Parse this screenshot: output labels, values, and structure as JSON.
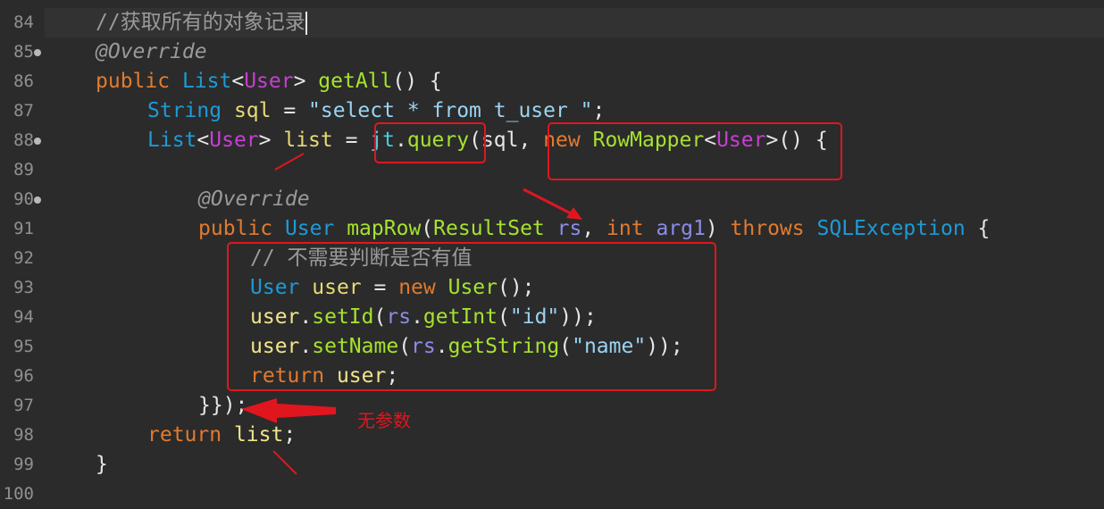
{
  "editor": {
    "line_numbers": [
      "84",
      "85",
      "86",
      "87",
      "88",
      "89",
      "90",
      "91",
      "92",
      "93",
      "94",
      "95",
      "96",
      "97",
      "98",
      "99",
      "100"
    ],
    "lines": {
      "l84": [
        "//获取所有的对象记录"
      ],
      "l85": [
        "@Override"
      ],
      "l86": [
        "public",
        " ",
        "List",
        "<",
        "User",
        "> ",
        "getAll",
        "() {"
      ],
      "l87": [
        "String",
        " ",
        "sql",
        " = ",
        "\"select * from t_user \"",
        ";"
      ],
      "l88": [
        "List",
        "<",
        "User",
        "> ",
        "list",
        " = ",
        "jt",
        ".",
        "query",
        "(sql, ",
        "new",
        " ",
        "RowMapper",
        "<",
        "User",
        ">() {"
      ],
      "l89": [
        ""
      ],
      "l90": [
        "@Override"
      ],
      "l91": [
        "public",
        " ",
        "User",
        " ",
        "mapRow",
        "(",
        "ResultSet",
        " ",
        "rs",
        ", ",
        "int",
        " ",
        "arg1",
        ") ",
        "throws",
        " ",
        "SQLException",
        " {"
      ],
      "l92": [
        "// 不需要判断是否有值"
      ],
      "l93": [
        "User",
        " ",
        "user",
        " = ",
        "new",
        " ",
        "User",
        "();"
      ],
      "l94": [
        "user",
        ".",
        "setId",
        "(",
        "rs",
        ".",
        "getInt",
        "(",
        "\"id\"",
        "));"
      ],
      "l95": [
        "user",
        ".",
        "setName",
        "(",
        "rs",
        ".",
        "getString",
        "(",
        "\"name\"",
        "));"
      ],
      "l96": [
        "return",
        " ",
        "user",
        ";"
      ],
      "l97": [
        "}});"
      ],
      "l98": [
        "return",
        " ",
        "list",
        ";"
      ],
      "l99": [
        "}"
      ]
    }
  },
  "annotations": {
    "note_text": "无参数",
    "box_color": "#e0161f",
    "arrow_color": "#e0161f"
  }
}
